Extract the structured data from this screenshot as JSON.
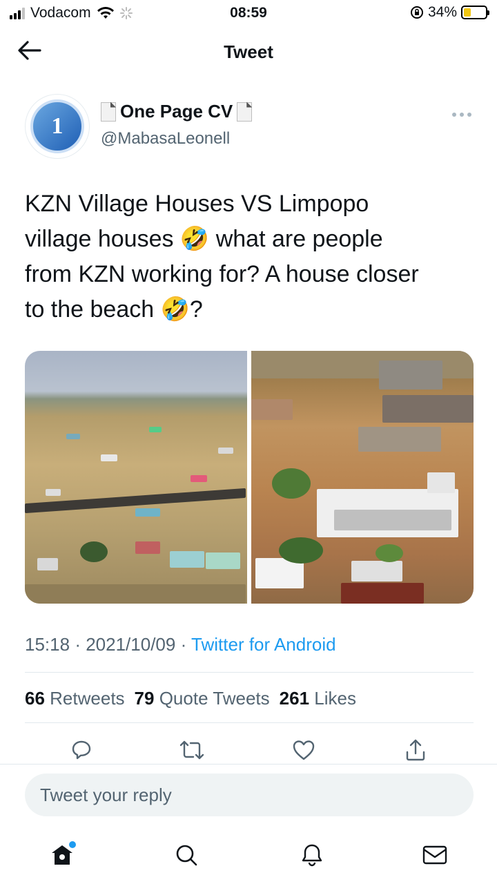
{
  "status_bar": {
    "carrier": "Vodacom",
    "time": "08:59",
    "battery_text": "34%",
    "battery_level": 0.34
  },
  "header": {
    "title": "Tweet"
  },
  "tweet": {
    "display_name": "One Page CV",
    "handle": "@MabasaLeonell",
    "avatar_label": "1",
    "text_lines": [
      "KZN Village Houses VS Limpopo",
      "village houses 🤣 what are people",
      "from KZN working for? A house closer",
      "to the beach 🤣?"
    ],
    "time": "15:18",
    "date": "2021/10/09",
    "source": "Twitter for Android",
    "separator": "·"
  },
  "stats": {
    "retweets_count": "66",
    "retweets_label": "Retweets",
    "quotes_count": "79",
    "quotes_label": "Quote Tweets",
    "likes_count": "261",
    "likes_label": "Likes"
  },
  "reply": {
    "placeholder": "Tweet your reply"
  },
  "icons": {
    "back": "arrow-left-icon",
    "more": "more-icon",
    "reply": "reply-icon",
    "retweet": "retweet-icon",
    "like": "heart-icon",
    "share": "share-icon",
    "home": "home-icon",
    "search": "search-icon",
    "notifications": "bell-icon",
    "messages": "mail-icon"
  },
  "colors": {
    "accent": "#1d9bf0",
    "text": "#0f1419",
    "secondary": "#536471"
  }
}
